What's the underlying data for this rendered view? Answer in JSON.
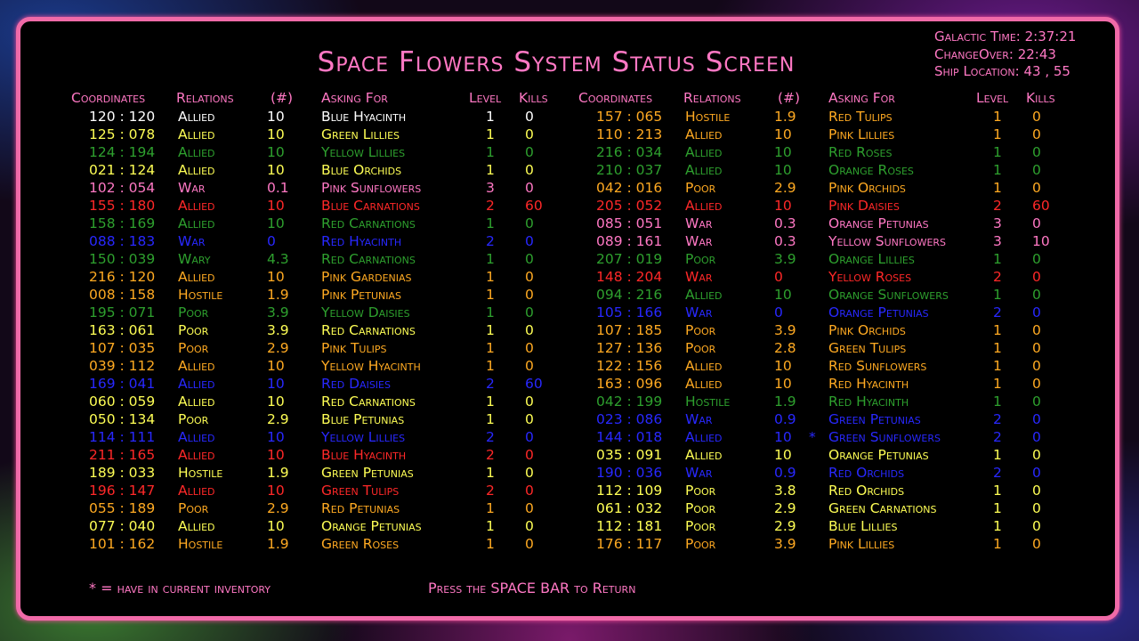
{
  "title": "Space Flowers System Status Screen",
  "info": {
    "galactic_time": "Galactic Time: 2:37:21",
    "changeover": "ChangeOver: 22:43",
    "ship_location": "Ship Location: 43 ,  55"
  },
  "headers": {
    "coordinates": "Coordinates",
    "relations": "Relations",
    "count": "(#)",
    "asking_for": "Asking For",
    "level": "Level",
    "kills": "Kills"
  },
  "colors": {
    "pink": "#ff78c4",
    "white": "#ffffff",
    "yellow": "#ffff55",
    "green": "#2ea02e",
    "red": "#ff2828",
    "blue": "#2828ff",
    "orange": "#ffaa22"
  },
  "left_rows": [
    {
      "coord": "120 : 120",
      "rel": "Allied",
      "num": "10",
      "ask": "Blue Hyacinth",
      "level": "1",
      "kills": "0",
      "color": "white"
    },
    {
      "coord": "125 : 078",
      "rel": "Allied",
      "num": "10",
      "ask": "Green Lillies",
      "level": "1",
      "kills": "0",
      "color": "yellow"
    },
    {
      "coord": "124 : 194",
      "rel": "Allied",
      "num": "10",
      "ask": "Yellow Lillies",
      "level": "1",
      "kills": "0",
      "color": "green"
    },
    {
      "coord": "021 : 124",
      "rel": "Allied",
      "num": "10",
      "ask": "Blue Orchids",
      "level": "1",
      "kills": "0",
      "color": "yellow"
    },
    {
      "coord": "102 : 054",
      "rel": "War",
      "num": "0.1",
      "ask": "Pink Sunflowers",
      "level": "3",
      "kills": "0",
      "color": "pink"
    },
    {
      "coord": "155 : 180",
      "rel": "Allied",
      "num": "10",
      "ask": "Blue Carnations",
      "level": "2",
      "kills": "60",
      "color": "red"
    },
    {
      "coord": "158 : 169",
      "rel": "Allied",
      "num": "10",
      "ask": "Red Carnations",
      "level": "1",
      "kills": "0",
      "color": "green"
    },
    {
      "coord": "088 : 183",
      "rel": "War",
      "num": "0",
      "ask": "Red Hyacinth",
      "level": "2",
      "kills": "0",
      "color": "blue"
    },
    {
      "coord": "150 : 039",
      "rel": "Wary",
      "num": "4.3",
      "ask": "Red Carnations",
      "level": "1",
      "kills": "0",
      "color": "green"
    },
    {
      "coord": "216 : 120",
      "rel": "Allied",
      "num": "10",
      "ask": "Pink Gardenias",
      "level": "1",
      "kills": "0",
      "color": "orange"
    },
    {
      "coord": "008 : 158",
      "rel": "Hostile",
      "num": "1.9",
      "ask": "Pink Petunias",
      "level": "1",
      "kills": "0",
      "color": "orange"
    },
    {
      "coord": "195 : 071",
      "rel": "Poor",
      "num": "3.9",
      "ask": "Yellow Daisies",
      "level": "1",
      "kills": "0",
      "color": "green"
    },
    {
      "coord": "163 : 061",
      "rel": "Poor",
      "num": "3.9",
      "ask": "Red Carnations",
      "level": "1",
      "kills": "0",
      "color": "yellow"
    },
    {
      "coord": "107 : 035",
      "rel": "Poor",
      "num": "2.9",
      "ask": "Pink Tulips",
      "level": "1",
      "kills": "0",
      "color": "orange"
    },
    {
      "coord": "039 : 112",
      "rel": "Allied",
      "num": "10",
      "ask": "Yellow Hyacinth",
      "level": "1",
      "kills": "0",
      "color": "orange"
    },
    {
      "coord": "169 : 041",
      "rel": "Allied",
      "num": "10",
      "ask": "Red Daisies",
      "level": "2",
      "kills": "60",
      "color": "blue"
    },
    {
      "coord": "060 : 059",
      "rel": "Allied",
      "num": "10",
      "ask": "Red Carnations",
      "level": "1",
      "kills": "0",
      "color": "yellow"
    },
    {
      "coord": "050 : 134",
      "rel": "Poor",
      "num": "2.9",
      "ask": "Blue Petunias",
      "level": "1",
      "kills": "0",
      "color": "yellow"
    },
    {
      "coord": "114 : 111",
      "rel": "Allied",
      "num": "10",
      "ask": "Yellow Lillies",
      "level": "2",
      "kills": "0",
      "color": "blue"
    },
    {
      "coord": "211 : 165",
      "rel": "Allied",
      "num": "10",
      "ask": "Blue Hyacinth",
      "level": "2",
      "kills": "0",
      "color": "red"
    },
    {
      "coord": "189 : 033",
      "rel": "Hostile",
      "num": "1.9",
      "ask": "Green Petunias",
      "level": "1",
      "kills": "0",
      "color": "yellow"
    },
    {
      "coord": "196 : 147",
      "rel": "Allied",
      "num": "10",
      "ask": "Green Tulips",
      "level": "2",
      "kills": "0",
      "color": "red"
    },
    {
      "coord": "055 : 189",
      "rel": "Poor",
      "num": "2.9",
      "ask": "Red Petunias",
      "level": "1",
      "kills": "0",
      "color": "orange"
    },
    {
      "coord": "077 : 040",
      "rel": "Allied",
      "num": "10",
      "ask": "Orange Petunias",
      "level": "1",
      "kills": "0",
      "color": "yellow"
    },
    {
      "coord": "101 : 162",
      "rel": "Hostile",
      "num": "1.9",
      "ask": "Green Roses",
      "level": "1",
      "kills": "0",
      "color": "orange"
    }
  ],
  "right_rows": [
    {
      "coord": "157 : 065",
      "rel": "Hostile",
      "num": "1.9",
      "ask": "Red Tulips",
      "level": "1",
      "kills": "0",
      "color": "orange",
      "star": ""
    },
    {
      "coord": "110 : 213",
      "rel": "Allied",
      "num": "10",
      "ask": "Pink Lillies",
      "level": "1",
      "kills": "0",
      "color": "orange",
      "star": ""
    },
    {
      "coord": "216 : 034",
      "rel": "Allied",
      "num": "10",
      "ask": "Red Roses",
      "level": "1",
      "kills": "0",
      "color": "green",
      "star": ""
    },
    {
      "coord": "210 : 037",
      "rel": "Allied",
      "num": "10",
      "ask": "Orange Roses",
      "level": "1",
      "kills": "0",
      "color": "green",
      "star": ""
    },
    {
      "coord": "042 : 016",
      "rel": "Poor",
      "num": "2.9",
      "ask": "Pink Orchids",
      "level": "1",
      "kills": "0",
      "color": "orange",
      "star": ""
    },
    {
      "coord": "205 : 052",
      "rel": "Allied",
      "num": "10",
      "ask": "Pink Daisies",
      "level": "2",
      "kills": "60",
      "color": "red",
      "star": ""
    },
    {
      "coord": "085 : 051",
      "rel": "War",
      "num": "0.3",
      "ask": "Orange Petunias",
      "level": "3",
      "kills": "0",
      "color": "pink",
      "star": ""
    },
    {
      "coord": "089 : 161",
      "rel": "War",
      "num": "0.3",
      "ask": "Yellow Sunflowers",
      "level": "3",
      "kills": "10",
      "color": "pink",
      "star": ""
    },
    {
      "coord": "207 : 019",
      "rel": "Poor",
      "num": "3.9",
      "ask": "Orange Lillies",
      "level": "1",
      "kills": "0",
      "color": "green",
      "star": ""
    },
    {
      "coord": "148 : 204",
      "rel": "War",
      "num": "0",
      "ask": "Yellow Roses",
      "level": "2",
      "kills": "0",
      "color": "red",
      "star": ""
    },
    {
      "coord": "094 : 216",
      "rel": "Allied",
      "num": "10",
      "ask": "Orange Sunflowers",
      "level": "1",
      "kills": "0",
      "color": "green",
      "star": ""
    },
    {
      "coord": "105 : 166",
      "rel": "War",
      "num": "0",
      "ask": "Orange Petunias",
      "level": "2",
      "kills": "0",
      "color": "blue",
      "star": ""
    },
    {
      "coord": "107 : 185",
      "rel": "Poor",
      "num": "3.9",
      "ask": "Pink Orchids",
      "level": "1",
      "kills": "0",
      "color": "orange",
      "star": ""
    },
    {
      "coord": "127 : 136",
      "rel": "Poor",
      "num": "2.8",
      "ask": "Green Tulips",
      "level": "1",
      "kills": "0",
      "color": "orange",
      "star": ""
    },
    {
      "coord": "122 : 156",
      "rel": "Allied",
      "num": "10",
      "ask": "Red Sunflowers",
      "level": "1",
      "kills": "0",
      "color": "orange",
      "star": ""
    },
    {
      "coord": "163 : 096",
      "rel": "Allied",
      "num": "10",
      "ask": "Red Hyacinth",
      "level": "1",
      "kills": "0",
      "color": "orange",
      "star": ""
    },
    {
      "coord": "042 : 199",
      "rel": "Hostile",
      "num": "1.9",
      "ask": "Red Hyacinth",
      "level": "1",
      "kills": "0",
      "color": "green",
      "star": ""
    },
    {
      "coord": "023 : 086",
      "rel": "War",
      "num": "0.9",
      "ask": "Green Petunias",
      "level": "2",
      "kills": "0",
      "color": "blue",
      "star": ""
    },
    {
      "coord": "144 : 018",
      "rel": "Allied",
      "num": "10",
      "ask": "Green Sunflowers",
      "level": "2",
      "kills": "0",
      "color": "blue",
      "star": "*"
    },
    {
      "coord": "035 : 091",
      "rel": "Allied",
      "num": "10",
      "ask": "Orange Petunias",
      "level": "1",
      "kills": "0",
      "color": "yellow",
      "star": ""
    },
    {
      "coord": "190 : 036",
      "rel": "War",
      "num": "0.9",
      "ask": "Red Orchids",
      "level": "2",
      "kills": "0",
      "color": "blue",
      "star": ""
    },
    {
      "coord": "112 : 109",
      "rel": "Poor",
      "num": "3.8",
      "ask": "Red Orchids",
      "level": "1",
      "kills": "0",
      "color": "yellow",
      "star": ""
    },
    {
      "coord": "061 : 032",
      "rel": "Poor",
      "num": "2.9",
      "ask": "Green Carnations",
      "level": "1",
      "kills": "0",
      "color": "yellow",
      "star": ""
    },
    {
      "coord": "112 : 181",
      "rel": "Poor",
      "num": "2.9",
      "ask": "Blue Lillies",
      "level": "1",
      "kills": "0",
      "color": "yellow",
      "star": ""
    },
    {
      "coord": "176 : 117",
      "rel": "Poor",
      "num": "3.9",
      "ask": "Pink Lillies",
      "level": "1",
      "kills": "0",
      "color": "orange",
      "star": ""
    }
  ],
  "footer": {
    "legend": "* = have in current inventory",
    "prompt": "Press the SPACE BAR to Return"
  }
}
